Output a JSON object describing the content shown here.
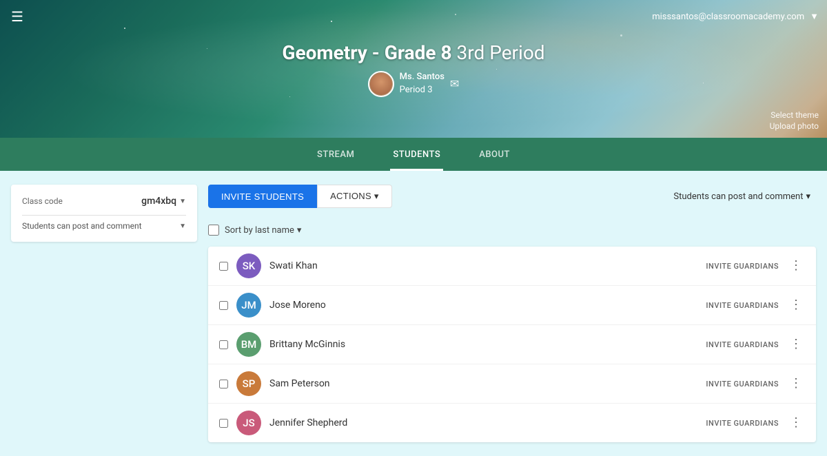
{
  "topbar": {
    "hamburger_label": "☰",
    "user_email": "misssantos@classroomacademy.com",
    "dropdown_arrow": "▼"
  },
  "hero": {
    "title_bold": "Geometry - Grade 8",
    "title_normal": " 3rd Period",
    "teacher_name": "Ms. Santos",
    "teacher_period": "Period 3",
    "select_theme": "Select theme",
    "upload_photo": "Upload photo"
  },
  "nav": {
    "items": [
      {
        "id": "stream",
        "label": "STREAM"
      },
      {
        "id": "students",
        "label": "STUDENTS"
      },
      {
        "id": "about",
        "label": "ABOUT"
      }
    ],
    "active": "students"
  },
  "sidebar": {
    "class_code_label": "Class code",
    "class_code_value": "gm4xbq",
    "permission_text": "Students can post and\ncomment"
  },
  "panel": {
    "tab_invite": "INVITE STUDENTS",
    "tab_actions": "ACTIONS",
    "actions_arrow": "▾",
    "permission_label": "Students can post and comment",
    "permission_arrow": "▾",
    "sort_label": "Sort by last name",
    "sort_arrow": "▾"
  },
  "students": [
    {
      "name": "Swati Khan",
      "invite": "INVITE GUARDIANS",
      "color": "#7c5cbf"
    },
    {
      "name": "Jose Moreno",
      "invite": "INVITE GUARDIANS",
      "color": "#3a8fc9"
    },
    {
      "name": "Brittany McGinnis",
      "invite": "INVITE GUARDIANS",
      "color": "#5a9e6f"
    },
    {
      "name": "Sam Peterson",
      "invite": "INVITE GUARDIANS",
      "color": "#c97a3a"
    },
    {
      "name": "Jennifer Shepherd",
      "invite": "INVITE GUARDIANS",
      "color": "#c95a7a"
    }
  ]
}
